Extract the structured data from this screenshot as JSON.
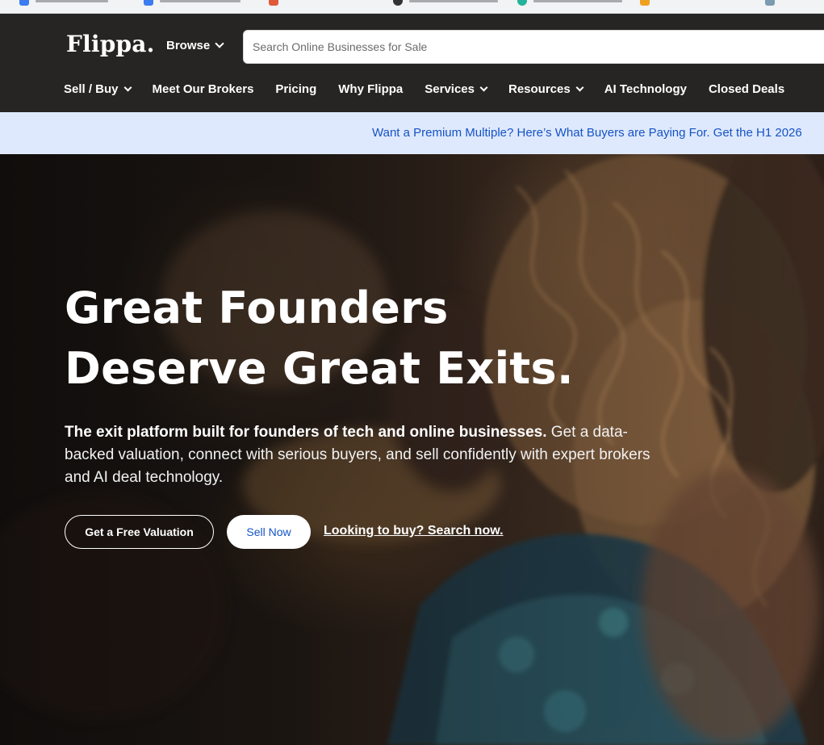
{
  "header": {
    "logo": "Flippa.",
    "browse_label": "Browse",
    "search": {
      "placeholder": "Search Online Businesses for Sale",
      "value": ""
    },
    "nav": [
      {
        "label": "Sell / Buy",
        "has_dropdown": true
      },
      {
        "label": "Meet Our Brokers",
        "has_dropdown": false
      },
      {
        "label": "Pricing",
        "has_dropdown": false
      },
      {
        "label": "Why Flippa",
        "has_dropdown": false
      },
      {
        "label": "Services",
        "has_dropdown": true
      },
      {
        "label": "Resources",
        "has_dropdown": true
      },
      {
        "label": "AI Technology",
        "has_dropdown": false
      },
      {
        "label": "Closed Deals",
        "has_dropdown": false
      }
    ]
  },
  "announcement": {
    "text": "Want a Premium Multiple? Here’s What Buyers are Paying For. Get the H1 2026"
  },
  "hero": {
    "title_line1": "Great Founders",
    "title_line2": "Deserve Great Exits.",
    "subtitle_bold": "The exit platform built for founders of tech and online businesses.",
    "subtitle_rest": " Get a data-backed valuation, connect with serious buyers, and sell confidently with expert brokers and AI deal technology.",
    "primary_button": "Get a Free Valuation",
    "secondary_button": "Sell Now",
    "buy_link": "Looking to buy? Search now."
  },
  "colors": {
    "header_bg": "#262524",
    "banner_bg": "#dfe9fd",
    "link_blue": "#1453c6",
    "white": "#ffffff"
  },
  "icons": [
    "chevron-down-icon"
  ]
}
